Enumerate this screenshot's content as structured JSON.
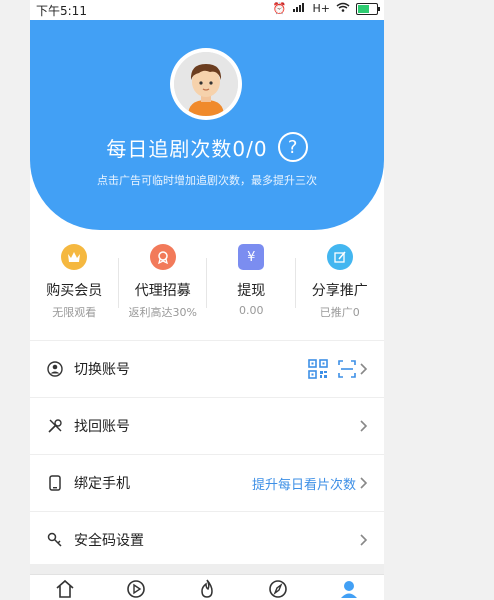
{
  "status_bar": {
    "time": "下午5:11",
    "network": "H+",
    "battery_level": 0.6
  },
  "header": {
    "title": "每日追剧次数0/0",
    "help_glyph": "?",
    "subtitle": "点击广告可临时增加追剧次数，最多提升三次"
  },
  "stats": [
    {
      "label": "购买会员",
      "sub": "无限观看",
      "icon": "crown-icon",
      "color": "#f5b840"
    },
    {
      "label": "代理招募",
      "sub": "返利高达30%",
      "icon": "badge-icon",
      "color": "#f27a5a"
    },
    {
      "label": "提现",
      "sub": "0.00",
      "icon": "yuan-icon",
      "color": "#7b8df0"
    },
    {
      "label": "分享推广",
      "sub": "已推广0",
      "icon": "share-edit-icon",
      "color": "#43b6f0"
    }
  ],
  "menu": [
    {
      "label": "切换账号",
      "icon": "user-switch-icon"
    },
    {
      "label": "找回账号",
      "icon": "tools-icon"
    },
    {
      "label": "绑定手机",
      "icon": "phone-icon",
      "hint": "提升每日看片次数"
    },
    {
      "label": "安全码设置",
      "icon": "key-icon"
    }
  ],
  "colors": {
    "primary": "#42a0f5",
    "hint_blue": "#3d8fe6"
  },
  "tabs": [
    "home-icon",
    "play-icon",
    "fire-icon",
    "compass-icon",
    "profile-icon"
  ]
}
